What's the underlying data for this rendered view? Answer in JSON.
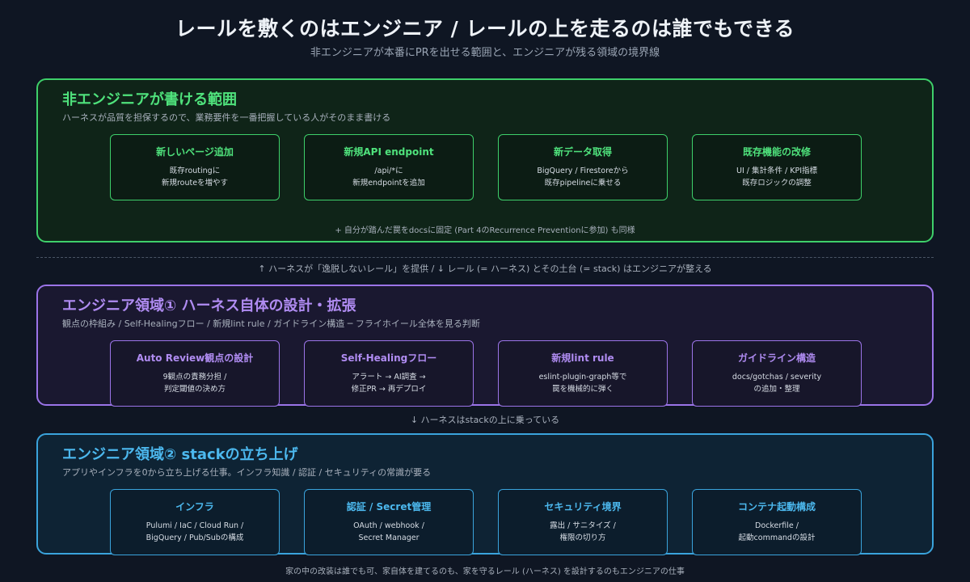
{
  "title": "レールを敷くのはエンジニア / レールの上を走るのは誰でもできる",
  "subtitle": "非エンジニアが本番にPRを出せる範囲と、エンジニアが残る領域の境界線",
  "sections": {
    "non_engineer": {
      "title": "非エンジニアが書ける範囲",
      "desc": "ハーネスが品質を担保するので、業務要件を一番把握している人がそのまま書ける",
      "accent": "#3ecf6a",
      "cards": [
        {
          "title": "新しいページ追加",
          "line1": "既存routingに",
          "line2": "新規routeを増やす"
        },
        {
          "title": "新規API endpoint",
          "line1": "/api/*に",
          "line2": "新規endpointを追加"
        },
        {
          "title": "新データ取得",
          "line1": "BigQuery / Firestoreから",
          "line2": "既存pipelineに乗せる"
        },
        {
          "title": "既存機能の改修",
          "line1": "UI / 集計条件 / KPI指標",
          "line2": "既存ロジックの調整"
        }
      ],
      "note": "+ 自分が踏んだ罠をdocsに固定 (Part 4のRecurrence Preventionに参加) も同様"
    },
    "engineer1": {
      "title": "エンジニア領域① ハーネス自体の設計・拡張",
      "desc": "観点の枠組み / Self-Healingフロー / 新規lint rule / ガイドライン構造 ─ フライホイール全体を見る判断",
      "accent": "#9b74e8",
      "cards": [
        {
          "title": "Auto Review観点の設計",
          "line1": "9観点の責務分担 /",
          "line2": "判定閾値の決め方"
        },
        {
          "title": "Self-Healingフロー",
          "line1": "アラート → AI調査 →",
          "line2": "修正PR → 再デプロイ"
        },
        {
          "title": "新規lint rule",
          "line1": "eslint-plugin-graph等で",
          "line2": "罠を機械的に弾く"
        },
        {
          "title": "ガイドライン構造",
          "line1": "docs/gotchas / severity",
          "line2": "の追加・整理"
        }
      ]
    },
    "engineer2": {
      "title": "エンジニア領域② stackの立ち上げ",
      "desc": "アプリやインフラを0から立ち上げる仕事。インフラ知識 / 認証 / セキュリティの常識が要る",
      "accent": "#3aa3dc",
      "cards": [
        {
          "title": "インフラ",
          "line1": "Pulumi / IaC / Cloud Run /",
          "line2": "BigQuery / Pub/Subの構成"
        },
        {
          "title": "認証 / Secret管理",
          "line1": "OAuth / webhook /",
          "line2": "Secret Manager"
        },
        {
          "title": "セキュリティ境界",
          "line1": "露出 / サニタイズ /",
          "line2": "権限の切り方"
        },
        {
          "title": "コンテナ起動構成",
          "line1": "Dockerfile /",
          "line2": "起動commandの設計"
        }
      ]
    }
  },
  "connector1": "↑ ハーネスが「逸脱しないレール」を提供 / ↓ レール (= ハーネス) とその土台 (= stack) はエンジニアが整える",
  "connector2": "↓ ハーネスはstackの上に乗っている",
  "footer": "家の中の改装は誰でも可、家自体を建てるのも、家を守るレール (ハーネス) を設計するのもエンジニアの仕事"
}
